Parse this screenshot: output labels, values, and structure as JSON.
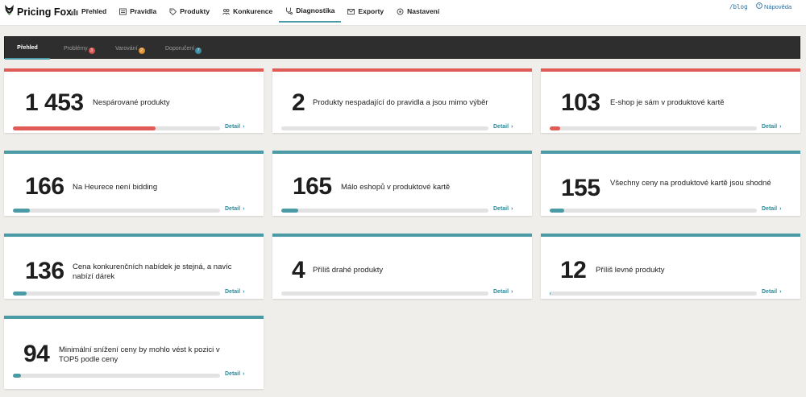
{
  "brand": {
    "name": "Pricing Fox"
  },
  "nav": {
    "items": [
      {
        "label": "Přehled",
        "icon": "bar-chart-icon"
      },
      {
        "label": "Pravidla",
        "icon": "list-icon"
      },
      {
        "label": "Produkty",
        "icon": "tag-icon"
      },
      {
        "label": "Konkurence",
        "icon": "users-icon"
      },
      {
        "label": "Diagnostika",
        "icon": "stethoscope-icon"
      },
      {
        "label": "Exporty",
        "icon": "envelope-icon"
      },
      {
        "label": "Nastavení",
        "icon": "gear-icon"
      }
    ],
    "active": "Diagnostika",
    "blog": "/blog",
    "help": "Nápověda"
  },
  "tabs": {
    "items": [
      {
        "label": "Přehled"
      },
      {
        "label": "Problémy",
        "badge": "3",
        "badge_color": "#d9534f"
      },
      {
        "label": "Varování",
        "badge": "2",
        "badge_color": "#e0902f"
      },
      {
        "label": "Doporučení",
        "badge": "7",
        "badge_color": "#3c8fa3"
      }
    ],
    "active": "Přehled"
  },
  "cards": [
    {
      "value": "1 453",
      "label": "Nespárované produkty",
      "progress": 0.69,
      "severity": "problem",
      "link": "Detail"
    },
    {
      "value": "2",
      "label": "Produkty nespadající do pravidla a jsou mimo výběr",
      "progress": 0.0,
      "severity": "problem",
      "link": "Detail"
    },
    {
      "value": "103",
      "label": "E-shop je sám v produktové kartě",
      "progress": 0.05,
      "severity": "problem",
      "link": "Detail"
    },
    {
      "value": "166",
      "label": "Na Heurece není bidding",
      "progress": 0.08,
      "severity": "recommendation",
      "link": "Detail"
    },
    {
      "value": "165",
      "label": "Málo eshopů v produktové kartě",
      "progress": 0.08,
      "severity": "recommendation",
      "link": "Detail"
    },
    {
      "value": "155",
      "label": "Všechny ceny na produktové kartě jsou shodné",
      "progress": 0.07,
      "severity": "recommendation",
      "link": "Detail"
    },
    {
      "value": "136",
      "label": "Cena konkurenčních nabídek je stejná, a navíc nabízí dárek",
      "progress": 0.065,
      "severity": "recommendation",
      "link": "Detail"
    },
    {
      "value": "4",
      "label": "Příliš drahé produkty",
      "progress": 0.0,
      "severity": "recommendation",
      "link": "Detail"
    },
    {
      "value": "12",
      "label": "Příliš levné produkty",
      "progress": 0.005,
      "severity": "recommendation",
      "link": "Detail"
    },
    {
      "value": "94",
      "label": "Minimální snížení ceny by mohlo vést k pozici v TOP5 podle ceny",
      "progress": 0.04,
      "severity": "recommendation",
      "link": "Detail"
    }
  ],
  "colors": {
    "problem": "#e05a56",
    "recommendation": "#4a9ba6",
    "accent": "#4a9ba6"
  }
}
